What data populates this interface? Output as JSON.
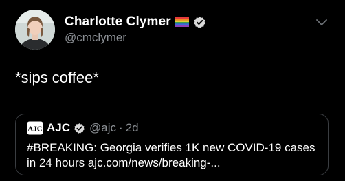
{
  "tweet": {
    "author": {
      "display_name": "Charlotte Clymer",
      "handle": "@cmclymer",
      "avatar_icon": "user-avatar",
      "flag_icon": "rainbow-flag-icon",
      "verified_icon": "verified-badge-icon"
    },
    "text": "*sips coffee*",
    "menu_icon": "chevron-down-icon",
    "quoted": {
      "logo_icon": "ajc-logo",
      "display_name": "AJC",
      "handle": "@ajc",
      "separator": "·",
      "time": "2d",
      "text_line1": "#BREAKING: Georgia verifies 1K new COVID-19 cases",
      "text_line2": "in 24 hours ajc.com/news/breaking-..."
    }
  },
  "colors": {
    "background": "#000000",
    "text_primary": "#ffffff",
    "text_secondary": "#8b8f94",
    "border": "#3a3d41",
    "verified_badge": "#d9d9d9"
  }
}
